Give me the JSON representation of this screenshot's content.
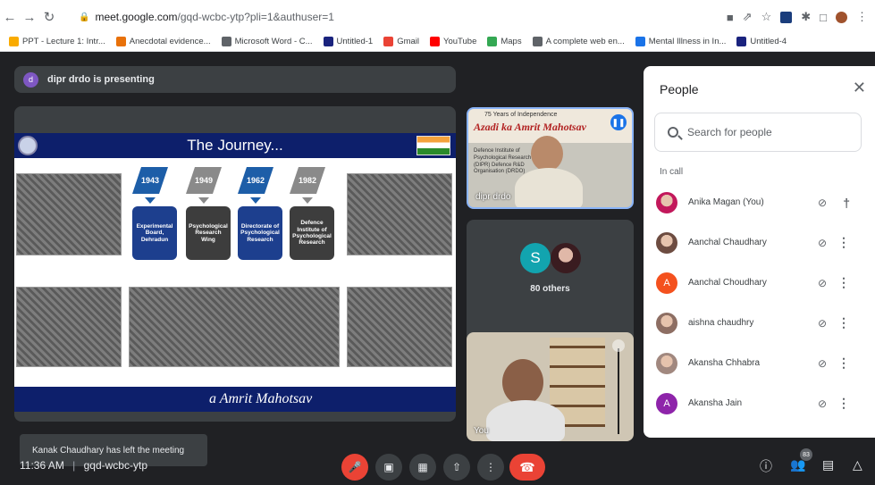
{
  "browser": {
    "url_host": "meet.google.com",
    "url_path": "/gqd-wcbc-ytp?pli=1&authuser=1",
    "bookmarks": [
      {
        "label": "PPT - Lecture 1: Intr...",
        "color": "#f9ab00"
      },
      {
        "label": "Anecdotal evidence...",
        "color": "#e8710a"
      },
      {
        "label": "Microsoft Word - C...",
        "color": "#5f6368"
      },
      {
        "label": "Untitled-1",
        "color": "#1a237e"
      },
      {
        "label": "Gmail",
        "color": "#ea4335"
      },
      {
        "label": "YouTube",
        "color": "#ff0000"
      },
      {
        "label": "Maps",
        "color": "#34a853"
      },
      {
        "label": "A complete web en...",
        "color": "#5f6368"
      },
      {
        "label": "Mental Illness in In...",
        "color": "#1a73e8"
      },
      {
        "label": "Untitled-4",
        "color": "#1a237e"
      }
    ]
  },
  "presenting": {
    "avatar_letter": "d",
    "label": "dipr drdo is presenting"
  },
  "slide": {
    "title": "The Journey...",
    "years": [
      "1943",
      "1949",
      "1962",
      "1982"
    ],
    "units": [
      "Experimental Board, Dehradun",
      "Psychological Research Wing",
      "Directorate of Psychological Research",
      "Defence Institute of Psychological Research"
    ],
    "footer": "a Amrit Mahotsav"
  },
  "toast": "Kanak Chaudhary has left the meeting",
  "tiles": {
    "presenter_name": "dipr drdo",
    "banner_line1": "75 Years of Independence",
    "banner_line2": "Azadi ka Amrit Mahotsav",
    "banner_line3": "Defence Institute of Psychological Research (DIPR) Defence R&D Organisation (DRDO)",
    "others_avatar_letter": "S",
    "others_label": "80 others",
    "self_name": "You"
  },
  "people": {
    "title": "People",
    "search_placeholder": "Search for people",
    "section": "In call",
    "participants": [
      {
        "name": "Anika Magan (You)",
        "avatar": "",
        "color": "#c2185b",
        "photo": true,
        "action": "pin"
      },
      {
        "name": "Aanchal Chaudhary",
        "avatar": "",
        "color": "#6d4c41",
        "photo": true,
        "action": "more"
      },
      {
        "name": "Aanchal Choudhary",
        "avatar": "A",
        "color": "#f4511e",
        "photo": false,
        "action": "more"
      },
      {
        "name": "aishna chaudhry",
        "avatar": "",
        "color": "#8d6e63",
        "photo": true,
        "action": "more"
      },
      {
        "name": "Akansha Chhabra",
        "avatar": "",
        "color": "#a1887f",
        "photo": true,
        "action": "more"
      },
      {
        "name": "Akansha Jain",
        "avatar": "A",
        "color": "#8e24aa",
        "photo": false,
        "action": "more"
      }
    ]
  },
  "bottom": {
    "time": "11:36 AM",
    "separator": "|",
    "code": "gqd-wcbc-ytp",
    "people_count": "83"
  }
}
